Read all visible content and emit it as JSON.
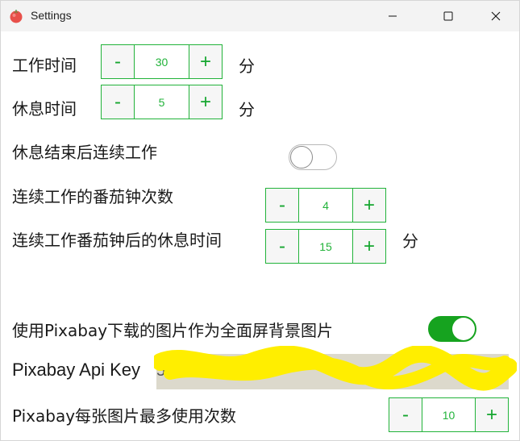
{
  "window": {
    "title": "Settings",
    "app_icon": "tomato-icon",
    "controls": [
      "minimize-icon",
      "maximize-icon",
      "close-icon"
    ]
  },
  "settings": {
    "work_time": {
      "label": "工作时间",
      "minus": "-",
      "value": "30",
      "plus": "+",
      "unit": "分"
    },
    "rest_time": {
      "label": "休息时间",
      "minus": "-",
      "value": "5",
      "plus": "+",
      "unit": "分"
    },
    "continue_after_rest": {
      "label": "休息结束后连续工作",
      "enabled": false
    },
    "consecutive_pomodoros": {
      "label": "连续工作的番茄钟次数",
      "minus": "-",
      "value": "4",
      "plus": "+"
    },
    "long_rest_time": {
      "label": "连续工作番茄钟后的休息时间",
      "minus": "-",
      "value": "15",
      "plus": "+",
      "unit": "分"
    },
    "pixabay_fullscreen": {
      "label": "使用Pixabay下载的图片作为全面屏背景图片",
      "enabled": true
    },
    "pixabay_api_key": {
      "label": "Pixabay Api Key",
      "value": "5"
    },
    "pixabay_max_uses": {
      "label": "Pixabay每张图片最多使用次数",
      "minus": "-",
      "value": "10",
      "plus": "+"
    }
  },
  "colors": {
    "accent": "#22b33a",
    "toggle_on": "#16a31f",
    "api_field_bg": "#dcd9cc",
    "redaction": "#ffee00"
  }
}
